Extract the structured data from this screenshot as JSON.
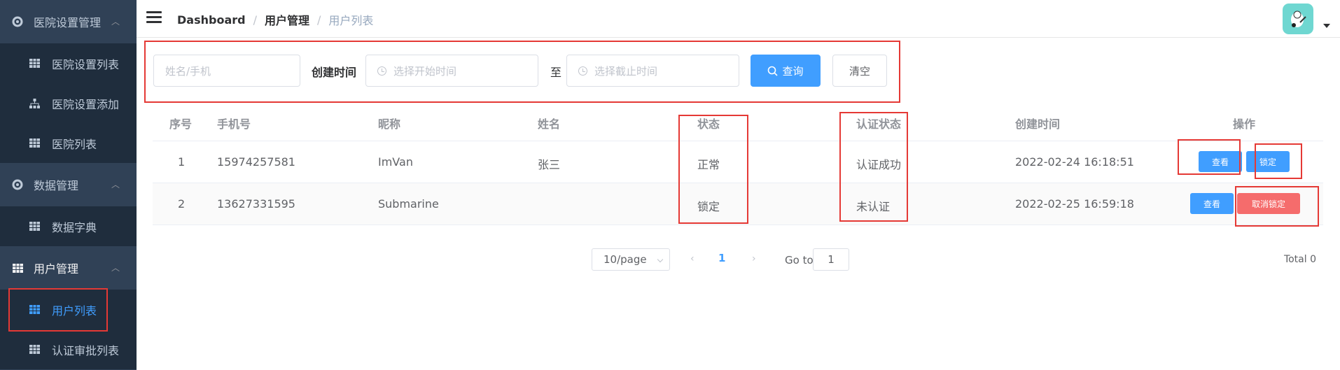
{
  "sidebar": {
    "groups": [
      {
        "label": "医院设置管理",
        "items": [
          "医院设置列表",
          "医院设置添加",
          "医院列表"
        ]
      },
      {
        "label": "数据管理",
        "items": [
          "数据字典"
        ]
      },
      {
        "label": "用户管理",
        "items": [
          "用户列表",
          "认证审批列表"
        ]
      }
    ],
    "active_item": "用户列表"
  },
  "navbar": {
    "breadcrumb": [
      "Dashboard",
      "用户管理",
      "用户列表"
    ],
    "separator": "/"
  },
  "search": {
    "name_placeholder": "姓名/手机",
    "created_label": "创建时间",
    "start_placeholder": "选择开始时间",
    "range_sep": "至",
    "end_placeholder": "选择截止时间",
    "query_label": "查询",
    "clear_label": "清空"
  },
  "table": {
    "columns": [
      "序号",
      "手机号",
      "昵称",
      "姓名",
      "状态",
      "认证状态",
      "创建时间",
      "操作"
    ],
    "rows": [
      {
        "index": "1",
        "phone": "15974257581",
        "nickname": "ImVan",
        "name": "张三",
        "status": "正常",
        "auth_status": "认证成功",
        "created": "2022-02-24 16:18:51",
        "view": "查看",
        "action": "锁定"
      },
      {
        "index": "2",
        "phone": "13627331595",
        "nickname": "Submarine",
        "name": "",
        "status": "锁定",
        "auth_status": "未认证",
        "created": "2022-02-25 16:59:18",
        "view": "查看",
        "action": "取消锁定"
      }
    ]
  },
  "pagination": {
    "page_size": "10/page",
    "current_page": "1",
    "prev": "‹",
    "next": "›",
    "goto_label": "Go to",
    "goto_value": "1",
    "total": "Total 0"
  },
  "colors": {
    "sidebar_bg": "#304156",
    "primary": "#409eff",
    "danger": "#f56c6c",
    "highlight": "#e53935"
  }
}
